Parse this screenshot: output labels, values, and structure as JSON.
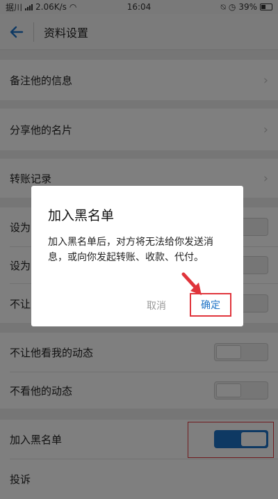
{
  "status_bar": {
    "carrier": "据川",
    "speed": "2.06K/s",
    "time": "16:04",
    "battery": "39%"
  },
  "header": {
    "title": "资料设置"
  },
  "list": {
    "note_info": "备注他的信息",
    "share_card": "分享他的名片",
    "transfer_records": "转账记录",
    "hidden_row_1": "设为",
    "hidden_row_2": "设为",
    "hidden_row_3": "不让",
    "hide_my_moments": "不让他看我的动态",
    "hide_his_moments": "不看他的动态",
    "add_blacklist": "加入黑名单",
    "report": "投诉"
  },
  "dialog": {
    "title": "加入黑名单",
    "message": "加入黑名单后，对方将无法给你发送消息，或向你发起转账、收款、代付。",
    "cancel": "取消",
    "confirm": "确定"
  },
  "colors": {
    "accent": "#1d72c6",
    "highlight": "#e0343b"
  },
  "toggles": {
    "add_blacklist_on": true
  }
}
